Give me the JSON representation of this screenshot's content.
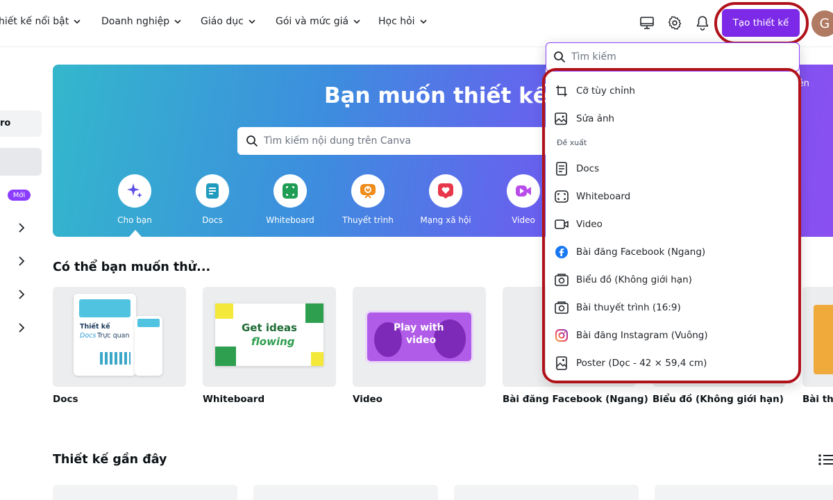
{
  "nav": {
    "items": [
      {
        "label": "hiết kế nổi bật"
      },
      {
        "label": "Doanh nghiệp"
      },
      {
        "label": "Giáo dục"
      },
      {
        "label": "Gói và mức giá"
      },
      {
        "label": "Học hỏi"
      }
    ],
    "create_label": "Tạo thiết kế",
    "avatar_initial": "G"
  },
  "sidebar": {
    "tab1_label": "ro",
    "badge_new": "Mới"
  },
  "hero": {
    "title": "Bạn muốn thiết kế g",
    "search_placeholder": "Tìm kiếm nội dung trên Canva",
    "right_button_fragment": "lên",
    "categories": [
      {
        "label": "Cho bạn",
        "color": "#5a4ee8"
      },
      {
        "label": "Docs",
        "color": "#1f9bbd"
      },
      {
        "label": "Whiteboard",
        "color": "#1f9d55"
      },
      {
        "label": "Thuyết trình",
        "color": "#f08c1a"
      },
      {
        "label": "Mạng xã hội",
        "color": "#e8364a"
      },
      {
        "label": "Video",
        "color": "#b84dea"
      }
    ]
  },
  "suggestions": {
    "title": "Có thể bạn muốn thử...",
    "cards": [
      {
        "label": "Docs",
        "thumb_title": "Thiết kế",
        "thumb_line2": "Docs",
        "thumb_line3": "Trực quan"
      },
      {
        "label": "Whiteboard",
        "thumb_line1": "Get ideas",
        "thumb_line2": "flowing"
      },
      {
        "label": "Video",
        "thumb_line1": "Play with",
        "thumb_line2": "video"
      },
      {
        "label": "Bài đăng Facebook (Ngang)"
      },
      {
        "label": "Biểu đồ (Không giới hạn)"
      },
      {
        "label": "Bài thu"
      }
    ]
  },
  "recent": {
    "title": "Thiết kế gần đây"
  },
  "dropdown": {
    "search_placeholder": "Tìm kiếm",
    "section_label": "Đề xuất",
    "items": [
      {
        "label": "Cỡ tùy chỉnh",
        "icon": "custom-size-icon"
      },
      {
        "label": "Sửa ảnh",
        "icon": "photo-edit-icon"
      },
      {
        "label": "Docs",
        "icon": "doc-icon"
      },
      {
        "label": "Whiteboard",
        "icon": "whiteboard-icon"
      },
      {
        "label": "Video",
        "icon": "video-icon"
      },
      {
        "label": "Bài đăng Facebook (Ngang)",
        "icon": "facebook-icon"
      },
      {
        "label": "Biểu đồ (Không giới hạn)",
        "icon": "chart-icon"
      },
      {
        "label": "Bài thuyết trình (16:9)",
        "icon": "presentation-icon"
      },
      {
        "label": "Bài đăng Instagram (Vuông)",
        "icon": "instagram-icon"
      },
      {
        "label": "Poster (Dọc - 42 × 59,4 cm)",
        "icon": "poster-icon"
      }
    ]
  },
  "colors": {
    "accent": "#7d2ae8",
    "highlight_ring": "#b0121b"
  }
}
